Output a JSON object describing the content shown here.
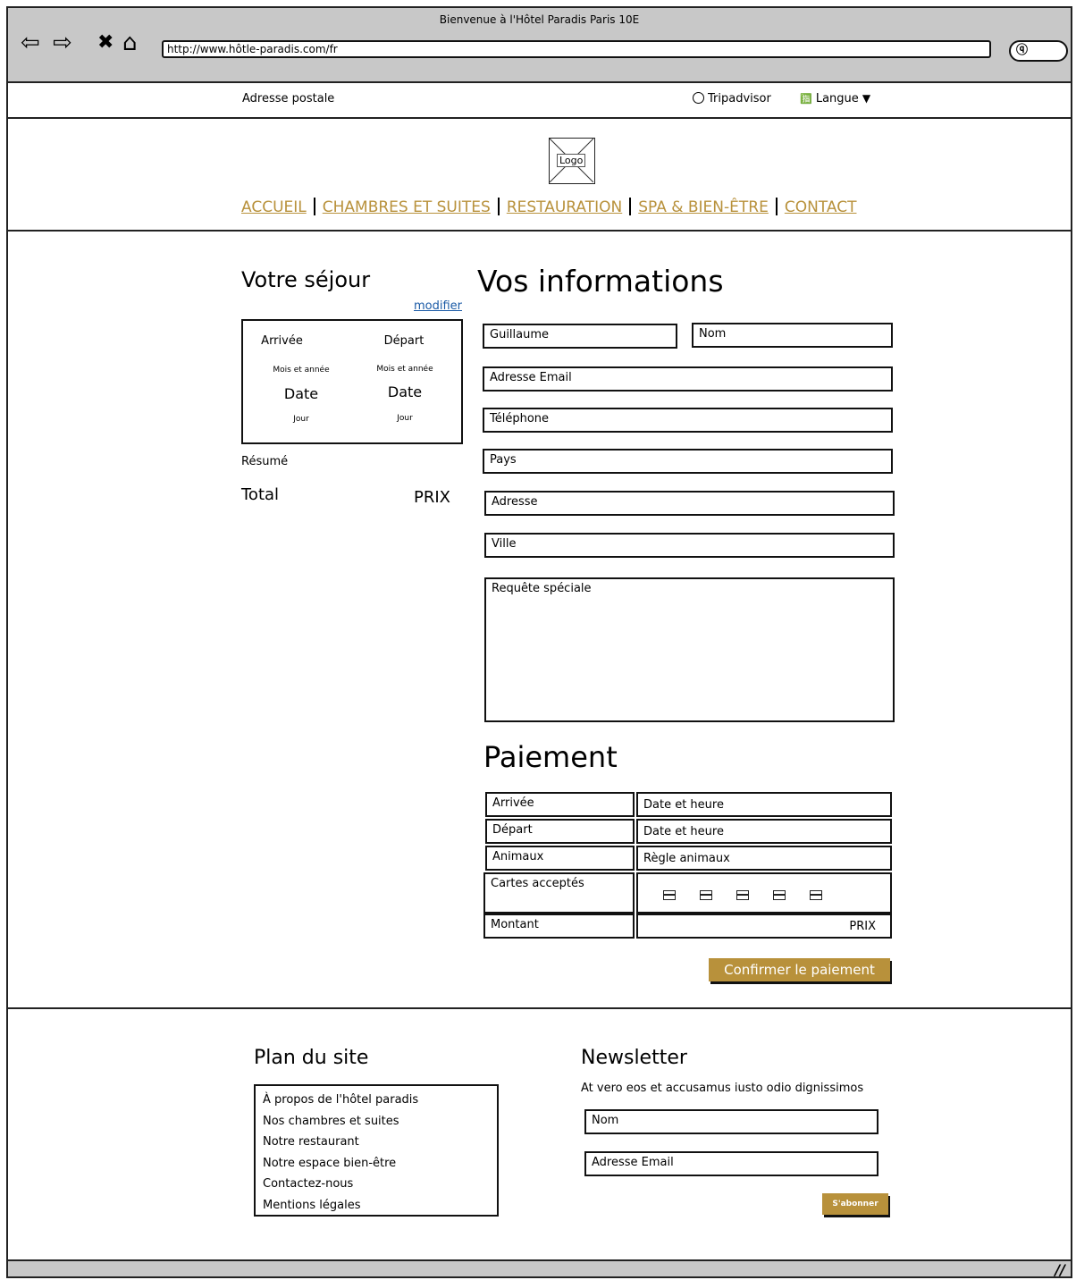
{
  "window": {
    "title": "Bienvenue à l'Hôtel Paradis Paris 10E",
    "url": "http://www.hôtle-paradis.com/fr"
  },
  "utility": {
    "address": "Adresse postale",
    "tripadvisor": "Tripadvisor",
    "language": "Langue"
  },
  "header": {
    "logo": "Logo",
    "nav": [
      "ACCUEIL",
      "CHAMBRES ET SUITES",
      "RESTAURATION",
      "SPA & BIEN-ÊTRE",
      "CONTACT"
    ],
    "nav_color": "#b8913b"
  },
  "stay": {
    "title": "Votre séjour",
    "edit_link": "modifier",
    "arrival": {
      "label": "Arrivée",
      "month_year": "Mois et année",
      "date": "Date",
      "day": "Jour"
    },
    "departure": {
      "label": "Départ",
      "month_year": "Mois et année",
      "date": "Date",
      "day": "Jour"
    },
    "summary": "Résumé",
    "total_label": "Total",
    "total_value": "PRIX"
  },
  "form": {
    "title": "Vos informations",
    "first_name": "Guillaume",
    "last_name": "Nom",
    "email": "Adresse Email",
    "phone": "Téléphone",
    "country": "Pays",
    "address": "Adresse",
    "city": "Ville",
    "special_request": "Requête spéciale"
  },
  "payment": {
    "title": "Paiement",
    "rows": [
      {
        "label": "Arrivée",
        "value": "Date et heure"
      },
      {
        "label": "Départ",
        "value": "Date et heure"
      },
      {
        "label": "Animaux",
        "value": "Règle animaux"
      },
      {
        "label": "Cartes acceptés",
        "value": ""
      },
      {
        "label": "Montant",
        "value": "PRIX"
      }
    ],
    "card_icons": [
      "credit-card-icon",
      "credit-card-icon",
      "credit-card-icon",
      "credit-card-icon",
      "credit-card-icon"
    ],
    "confirm_button": "Confirmer le paiement",
    "accent_color": "#b8913b"
  },
  "footer": {
    "sitemap_title": "Plan du site",
    "sitemap_links": [
      "À propos de l'hôtel paradis",
      "Nos chambres et suites",
      "Notre restaurant",
      "Notre espace bien-être",
      "Contactez-nous",
      "Mentions légales"
    ],
    "newsletter_title": "Newsletter",
    "newsletter_text": "At vero eos et accusamus iusto odio dignissimos",
    "name_placeholder": "Nom",
    "email_placeholder": "Adresse Email",
    "subscribe_button": "S'abonner"
  }
}
